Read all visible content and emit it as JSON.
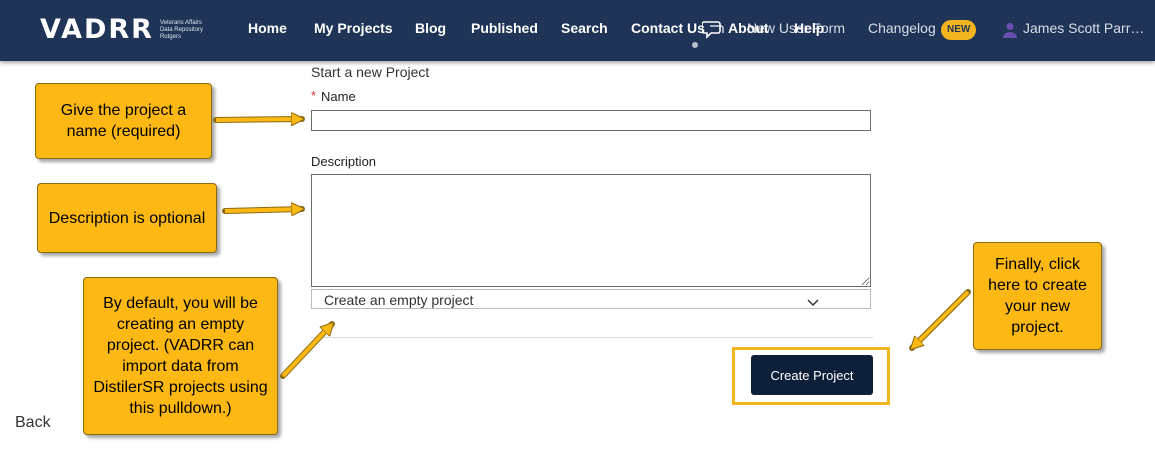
{
  "header": {
    "logo": "VADRR",
    "logo_sub": [
      "Veterans Affairs",
      "Data Repository",
      "Rutgers"
    ],
    "nav": [
      {
        "label": "Home"
      },
      {
        "label": "My Projects"
      },
      {
        "label": "Blog"
      },
      {
        "label": "Published"
      },
      {
        "label": "Search"
      },
      {
        "label": "Contact Us"
      },
      {
        "label": "About"
      },
      {
        "label": "Help"
      }
    ],
    "feedback_label": "New User Form",
    "changelog_label": "Changelog",
    "badge": "NEW",
    "user_name": "James Scott Parr…",
    "icons": [
      "chat-icon",
      "user-icon"
    ],
    "colors": {
      "nav_bg": "#1f3457",
      "accent": "#f2b51d"
    }
  },
  "form": {
    "title": "Start a new Project",
    "required_mark": "*",
    "name_label": "Name",
    "name_value": "",
    "description_label": "Description",
    "description_value": "",
    "template_select": "Create an empty project",
    "create_button": "Create Project",
    "back_link": "Back"
  },
  "callouts": {
    "name": "Give the project a name (required)",
    "description": "Description is optional",
    "template": "By default, you will be creating an empty project. (VADRR can import data from DistilerSR projects using this pulldown.)",
    "create": "Finally, click here to create your new project.",
    "color": "#fdb813"
  }
}
